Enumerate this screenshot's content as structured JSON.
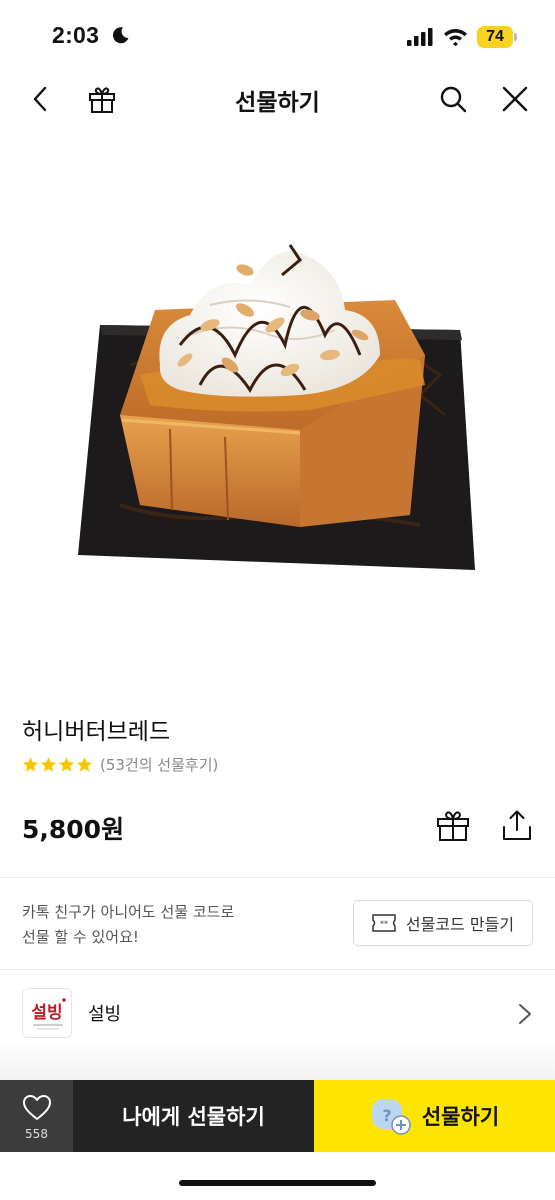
{
  "status_bar": {
    "time": "2:03",
    "battery": "74"
  },
  "nav": {
    "title": "선물하기"
  },
  "product": {
    "name": "허니버터브레드",
    "rating_stars": 4,
    "review_count": "(53건의 선물후기)",
    "price": "5,800원"
  },
  "gift_code": {
    "description_line1": "카톡 친구가 아니어도 선물 코드로",
    "description_line2": "선물 할 수 있어요!",
    "button_label": "선물코드 만들기"
  },
  "brand": {
    "name": "설빙",
    "logo_text": "설빙"
  },
  "bottom_bar": {
    "wish_count": "558",
    "self_gift_label": "나에게 선물하기",
    "gift_label": "선물하기"
  },
  "colors": {
    "accent": "#fee500",
    "star": "#f7c600",
    "dark_button": "#232323"
  }
}
